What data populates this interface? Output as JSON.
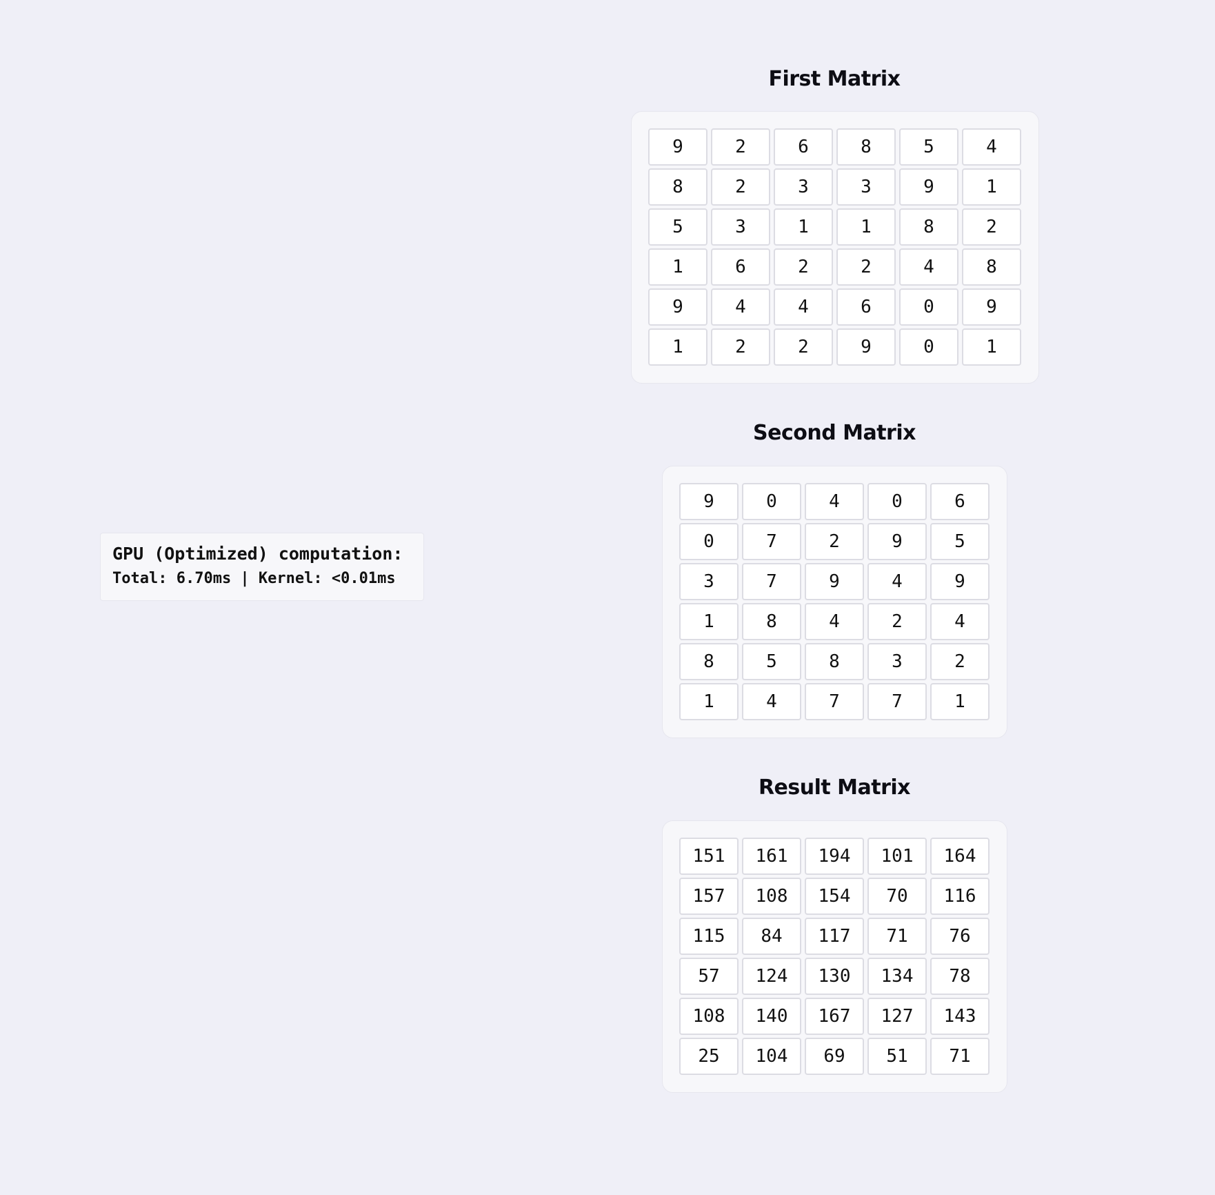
{
  "status": {
    "line1": "GPU (Optimized) computation:",
    "line2": "Total: 6.70ms | Kernel: <0.01ms"
  },
  "matrices": [
    {
      "title": "First Matrix",
      "rows": [
        [
          9,
          2,
          6,
          8,
          5,
          4
        ],
        [
          8,
          2,
          3,
          3,
          9,
          1
        ],
        [
          5,
          3,
          1,
          1,
          8,
          2
        ],
        [
          1,
          6,
          2,
          2,
          4,
          8
        ],
        [
          9,
          4,
          4,
          6,
          0,
          9
        ],
        [
          1,
          2,
          2,
          9,
          0,
          1
        ]
      ]
    },
    {
      "title": "Second Matrix",
      "rows": [
        [
          9,
          0,
          4,
          0,
          6
        ],
        [
          0,
          7,
          2,
          9,
          5
        ],
        [
          3,
          7,
          9,
          4,
          9
        ],
        [
          1,
          8,
          4,
          2,
          4
        ],
        [
          8,
          5,
          8,
          3,
          2
        ],
        [
          1,
          4,
          7,
          7,
          1
        ]
      ]
    },
    {
      "title": "Result Matrix",
      "rows": [
        [
          151,
          161,
          194,
          101,
          164
        ],
        [
          157,
          108,
          154,
          70,
          116
        ],
        [
          115,
          84,
          117,
          71,
          76
        ],
        [
          57,
          124,
          130,
          134,
          78
        ],
        [
          108,
          140,
          167,
          127,
          143
        ],
        [
          25,
          104,
          69,
          51,
          71
        ]
      ]
    }
  ]
}
